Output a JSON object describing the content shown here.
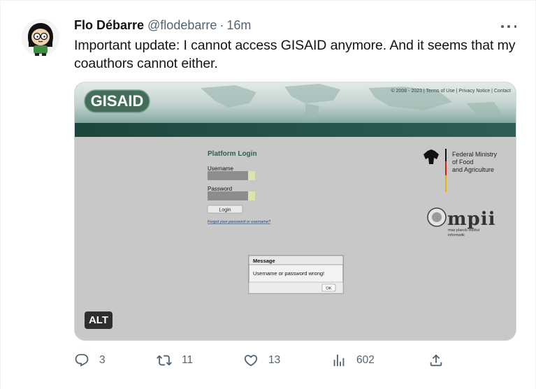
{
  "author": {
    "name": "Flo Débarre",
    "handle": "@flodebarre",
    "separator": "·",
    "time": "16m"
  },
  "tweet": {
    "text": "Important update: I cannot access GISAID anymore. And it seems that my coauthors cannot either."
  },
  "media": {
    "alt_label": "ALT",
    "screenshot": {
      "logo": "GISAID",
      "top_links": "© 2008 - 2023 | Terms of Use | Privacy Notice | Contact",
      "platform_login": "Platform Login",
      "username_label": "Username",
      "password_label": "Password",
      "login_button": "Login",
      "forgot_link": "Forgot your password or username?",
      "ministry_line1": "Federal Ministry",
      "ministry_line2": "of Food",
      "ministry_line3": "and Agriculture",
      "mpii_logo": "mpii",
      "mpii_line1": "max planck institut",
      "mpii_line2": "informatik",
      "dialog_title": "Message",
      "dialog_message": "Username or password wrong!",
      "dialog_ok": "OK"
    }
  },
  "actions": {
    "replies": "3",
    "retweets": "11",
    "likes": "13",
    "views": "602"
  },
  "colors": {
    "gisaid_green": "#3e6e56",
    "gisaid_teal": "#1f4d45",
    "page_gray": "#c8c8c8",
    "login_title": "#2d5e52",
    "muted_text": "#536471"
  }
}
